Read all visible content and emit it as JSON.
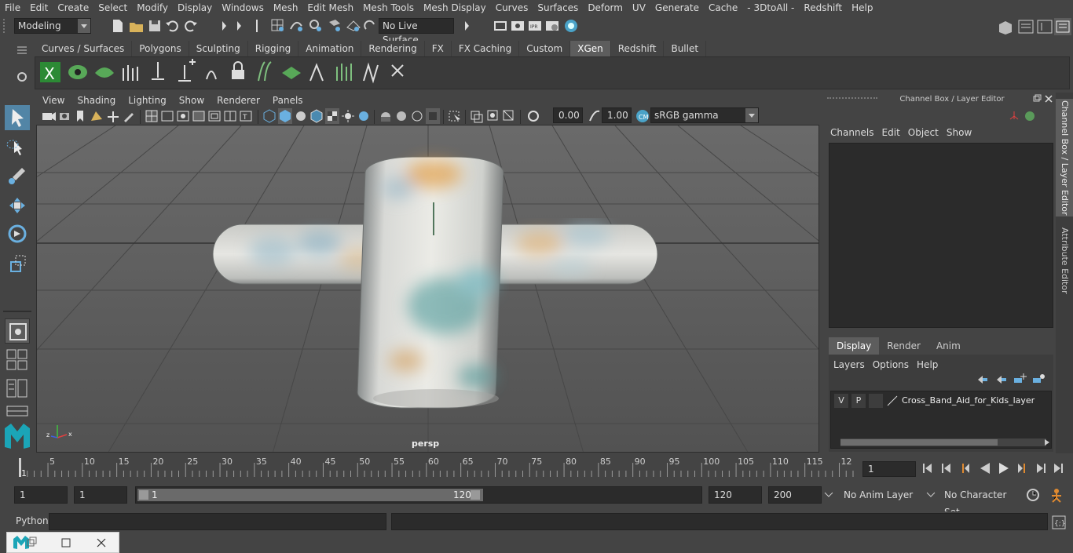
{
  "menubar": {
    "items": [
      "File",
      "Edit",
      "Create",
      "Select",
      "Modify",
      "Display",
      "Windows",
      "Mesh",
      "Edit Mesh",
      "Mesh Tools",
      "Mesh Display",
      "Curves",
      "Surfaces",
      "Deform",
      "UV",
      "Generate",
      "Cache",
      "- 3DtoAll -",
      "Redshift",
      "Help"
    ]
  },
  "statusline": {
    "mode": "Modeling",
    "live_surface": "No Live Surface"
  },
  "shelf": {
    "tabs": [
      "Curves / Surfaces",
      "Polygons",
      "Sculpting",
      "Rigging",
      "Animation",
      "Rendering",
      "FX",
      "FX Caching",
      "Custom",
      "XGen",
      "Redshift",
      "Bullet"
    ],
    "active_tab": "XGen"
  },
  "viewport": {
    "menu": [
      "View",
      "Shading",
      "Lighting",
      "Show",
      "Renderer",
      "Panels"
    ],
    "exposure": "0.00",
    "gamma": "1.00",
    "color_space": "sRGB gamma",
    "camera_label": "persp"
  },
  "channel_box": {
    "title": "Channel Box / Layer Editor",
    "menu": [
      "Channels",
      "Edit",
      "Object",
      "Show"
    ]
  },
  "layer_editor": {
    "tabs": [
      "Display",
      "Render",
      "Anim"
    ],
    "active_tab": "Display",
    "menu": [
      "Layers",
      "Options",
      "Help"
    ],
    "layers": [
      {
        "v": "V",
        "p": "P",
        "name": "Cross_Band_Aid_for_Kids_layer"
      }
    ]
  },
  "side_tabs": [
    "Channel Box / Layer Editor",
    "Attribute Editor"
  ],
  "timeline": {
    "ticks": [
      "5",
      "10",
      "15",
      "20",
      "25",
      "30",
      "35",
      "40",
      "45",
      "50",
      "55",
      "60",
      "65",
      "70",
      "75",
      "80",
      "85",
      "90",
      "95",
      "100",
      "105",
      "110",
      "115",
      "12"
    ],
    "start_marker": "1",
    "current_frame": "1"
  },
  "range": {
    "start": "1",
    "start2": "1",
    "slider_start": "1",
    "slider_end": "120",
    "end": "120",
    "end2": "200",
    "anim_layer": "No Anim Layer",
    "character_set": "No Character Set"
  },
  "cmdline": {
    "label": "Python"
  },
  "colors": {
    "ui_bg": "#444444",
    "field_bg": "#2b2b2b",
    "viewport_bg": "#5b5b5b",
    "accent_active": "#5d5d5d",
    "select_blue": "#5285a6"
  }
}
